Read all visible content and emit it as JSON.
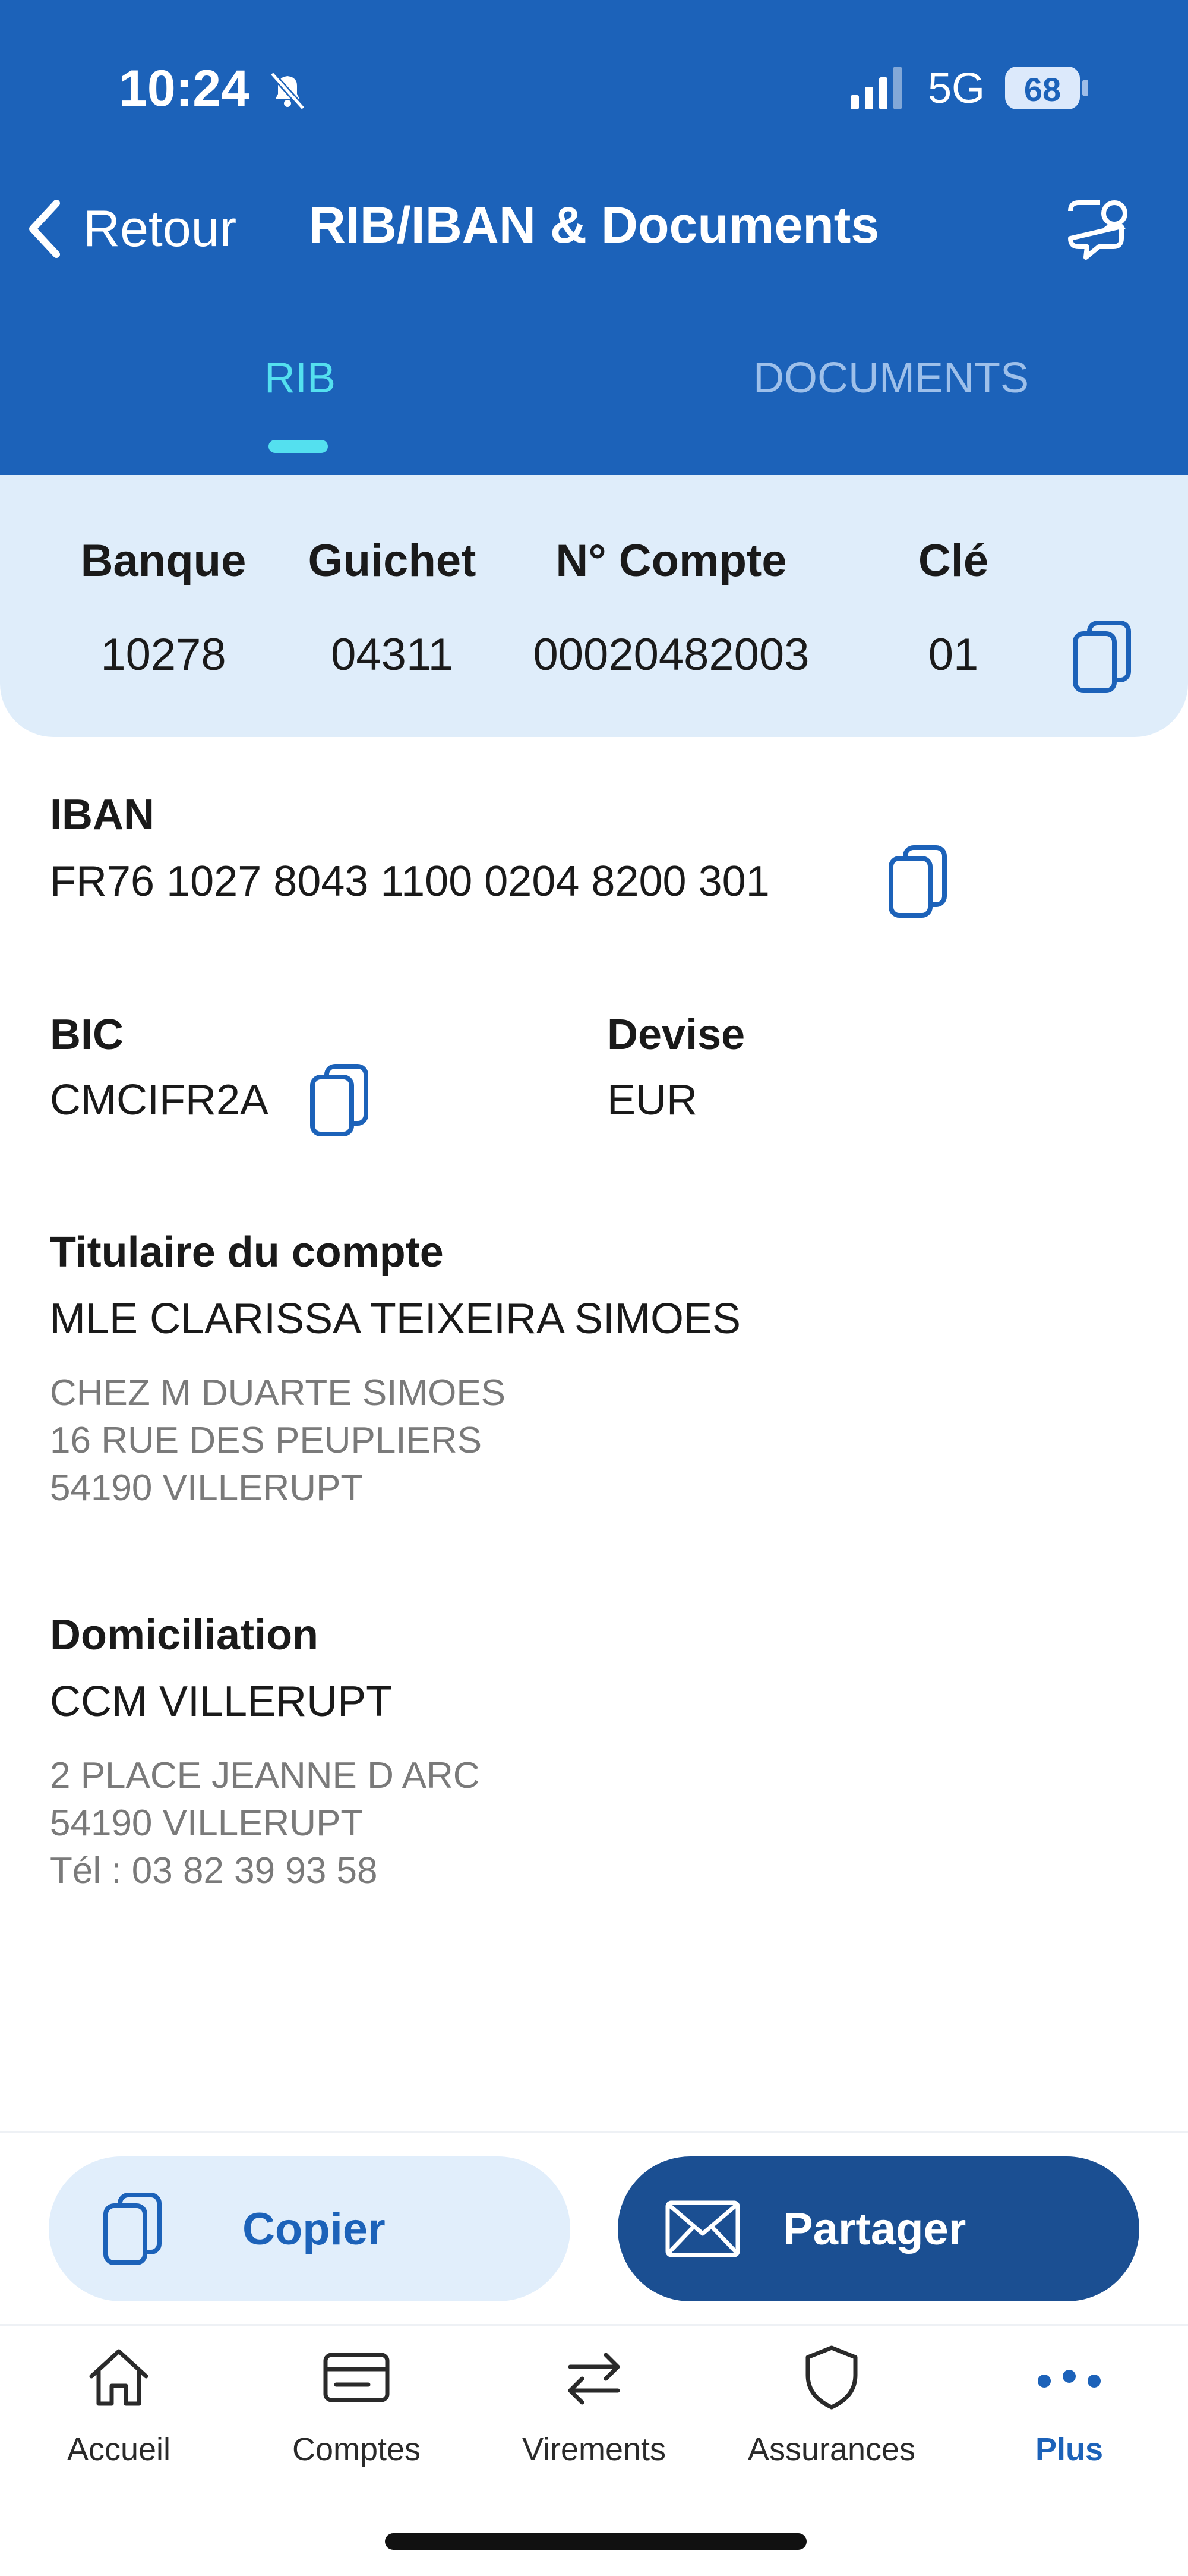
{
  "status_bar": {
    "time": "10:24",
    "network": "5G",
    "battery": "68"
  },
  "header": {
    "back_label": "Retour",
    "title": "RIB/IBAN & Documents"
  },
  "tabs": [
    {
      "label": "RIB",
      "active": true
    },
    {
      "label": "DOCUMENTS",
      "active": false
    }
  ],
  "rib": {
    "headers": [
      "Banque",
      "Guichet",
      "N° Compte",
      "Clé"
    ],
    "values": [
      "10278",
      "04311",
      "00020482003",
      "01"
    ]
  },
  "iban": {
    "label": "IBAN",
    "value": "FR76 1027 8043 1100 0204 8200 301"
  },
  "bic": {
    "label": "BIC",
    "value": "CMCIFR2A"
  },
  "devise": {
    "label": "Devise",
    "value": "EUR"
  },
  "titulaire": {
    "label": "Titulaire du compte",
    "name": "MLE CLARISSA TEIXEIRA SIMOES",
    "address": [
      "CHEZ M DUARTE SIMOES",
      "16 RUE DES PEUPLIERS",
      "54190 VILLERUPT"
    ]
  },
  "domiciliation": {
    "label": "Domiciliation",
    "name": "CCM VILLERUPT",
    "address": [
      "2 PLACE JEANNE D ARC",
      "54190 VILLERUPT",
      "Tél : 03 82 39 93 58"
    ]
  },
  "actions": {
    "copy_label": "Copier",
    "share_label": "Partager"
  },
  "tab_bar": [
    {
      "label": "Accueil",
      "icon": "home-icon",
      "active": false
    },
    {
      "label": "Comptes",
      "icon": "card-icon",
      "active": false
    },
    {
      "label": "Virements",
      "icon": "transfer-icon",
      "active": false
    },
    {
      "label": "Assurances",
      "icon": "shield-icon",
      "active": false
    },
    {
      "label": "Plus",
      "icon": "more-dots-icon",
      "active": true
    }
  ],
  "colors": {
    "primary": "#1c62b9",
    "accent": "#54e0ef",
    "panel": "#dfedfa",
    "share_button": "#1b4f92"
  }
}
